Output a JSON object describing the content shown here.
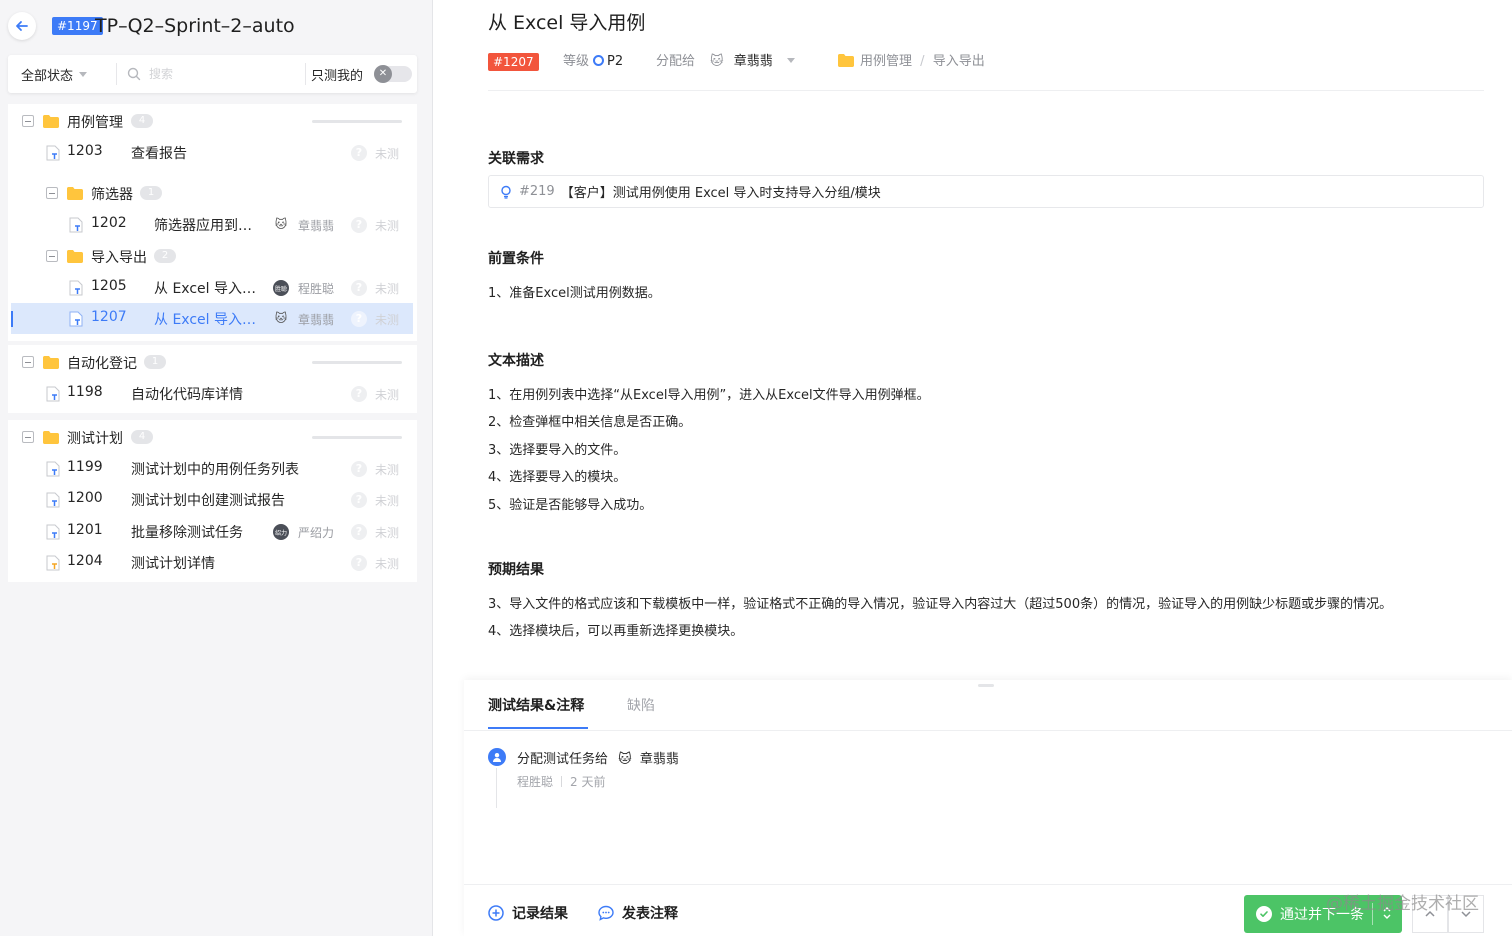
{
  "header": {
    "plan_badge": "#1197",
    "plan_title": "TP–Q2–Sprint–2–auto"
  },
  "filter": {
    "status_label": "全部状态",
    "search_placeholder": "搜索",
    "only_mine_label": "只测我的",
    "toggle_symbol": "✕"
  },
  "tree": {
    "groups": [
      {
        "label": "用例管理",
        "count": "4"
      },
      {
        "label": "筛选器",
        "count": "1"
      },
      {
        "label": "导入导出",
        "count": "2"
      },
      {
        "label": "自动化登记",
        "count": "1"
      },
      {
        "label": "测试计划",
        "count": "4"
      }
    ],
    "cases": [
      {
        "id": "1203",
        "name": "查看报告",
        "assignee": "",
        "status": "未测"
      },
      {
        "id": "1202",
        "name": "筛选器应用到…",
        "assignee": "章翡翡",
        "status": "未测"
      },
      {
        "id": "1205",
        "name": "从 Excel 导入…",
        "assignee": "程胜聪",
        "avatar_text": "胜聪",
        "status": "未测"
      },
      {
        "id": "1207",
        "name": "从 Excel 导入…",
        "assignee": "章翡翡",
        "status": "未测"
      },
      {
        "id": "1198",
        "name": "自动化代码库详情",
        "assignee": "",
        "status": "未测"
      },
      {
        "id": "1199",
        "name": "测试计划中的用例任务列表",
        "assignee": "",
        "status": "未测"
      },
      {
        "id": "1200",
        "name": "测试计划中创建测试报告",
        "assignee": "",
        "status": "未测"
      },
      {
        "id": "1201",
        "name": "批量移除测试任务",
        "assignee": "严绍力",
        "avatar_text": "绍力",
        "status": "未测"
      },
      {
        "id": "1204",
        "name": "测试计划详情",
        "assignee": "",
        "status": "未测"
      }
    ],
    "question_mark": "?"
  },
  "detail": {
    "title": "从 Excel 导入用例",
    "badge": "#1207",
    "level_label": "等级",
    "level_value": "P2",
    "assign_label": "分配给",
    "assignee": "章翡翡",
    "breadcrumb_1": "用例管理",
    "breadcrumb_sep": "/",
    "breadcrumb_2": "导入导出",
    "sections": {
      "requirement": "关联需求",
      "precondition": "前置条件",
      "description": "文本描述",
      "expected": "预期结果"
    },
    "requirement": {
      "id": "#219",
      "text": "【客户】测试用例使用 Excel 导入时支持导入分组/模块"
    },
    "precondition_lines": [
      "1、准备Excel测试用例数据。"
    ],
    "description_lines": [
      "1、在用例列表中选择“从Excel导入用例”，进入从Excel文件导入用例弹框。",
      "2、检查弹框中相关信息是否正确。",
      "3、选择要导入的文件。",
      "4、选择要导入的模块。",
      "5、验证是否能够导入成功。"
    ],
    "expected_lines": [
      "3、导入文件的格式应该和下载模板中一样，验证格式不正确的导入情况，验证导入内容过大（超过500条）的情况，验证导入的用例缺少标题或步骤的情况。",
      "4、选择模块后，可以再重新选择更换模块。"
    ]
  },
  "panel": {
    "tab_results": "测试结果&注释",
    "tab_defects": "缺陷",
    "activity_text": "分配测试任务给",
    "activity_target": "章翡翡",
    "activity_actor": "程胜聪",
    "activity_time": "2 天前"
  },
  "footer": {
    "record_label": "记录结果",
    "comment_label": "发表注释",
    "pass_label": "通过并下一条",
    "watermark": "@稀土掘金技术社区"
  },
  "colors": {
    "accent": "#3d7bf7",
    "badge_red": "#f2553c",
    "pass_green": "#4cc466",
    "folder": "#ffc53d"
  }
}
